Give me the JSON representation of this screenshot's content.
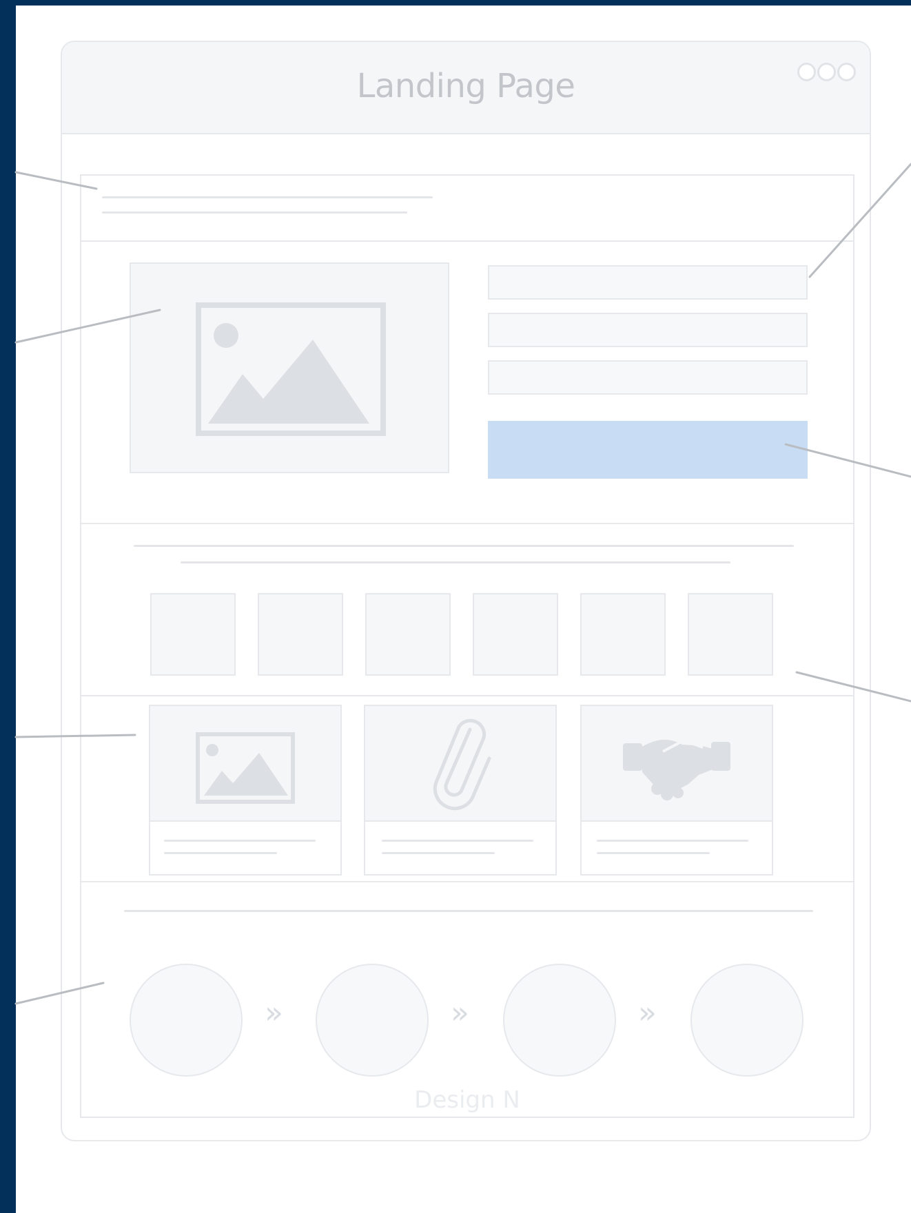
{
  "window": {
    "title": "Landing Page",
    "window_controls_icon": "three-circles-icon"
  },
  "hero": {
    "image_icon": "image-placeholder-icon",
    "form_fields": 3,
    "cta_color": "#c8ddf3"
  },
  "logos": {
    "count": 6
  },
  "features": {
    "cards": [
      {
        "icon": "image-placeholder-icon"
      },
      {
        "icon": "paperclip-icon"
      },
      {
        "icon": "handshake-icon"
      }
    ]
  },
  "steps": {
    "count": 4,
    "separator_icon": "double-chevron-right-icon",
    "separator_glyph": "»"
  },
  "footer": {
    "text": "Design N"
  },
  "colors": {
    "frame": "#03305a",
    "border": "#e6e8ec",
    "panel": "#f5f6f8",
    "cta": "#c8ddf3"
  }
}
